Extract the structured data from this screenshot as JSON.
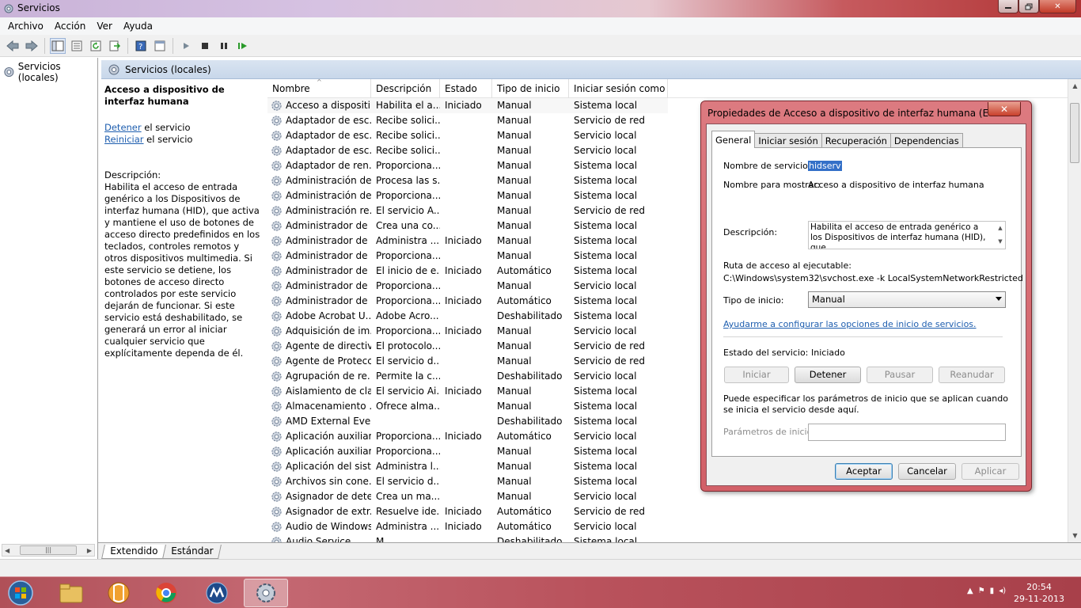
{
  "window": {
    "title": "Servicios"
  },
  "menu": [
    "Archivo",
    "Acción",
    "Ver",
    "Ayuda"
  ],
  "tree": {
    "root_label": "Servicios (locales)"
  },
  "pane": {
    "header": "Servicios (locales)"
  },
  "detail": {
    "title": "Acceso a dispositivo de interfaz humana",
    "stop_link": "Detener",
    "stop_suffix": " el servicio",
    "restart_link": "Reiniciar",
    "restart_suffix": " el servicio",
    "description_label": "Descripción:",
    "description": "Habilita el acceso de entrada genérico a los Dispositivos de interfaz humana (HID), que activa y mantiene el uso de botones de acceso directo predefinidos en los teclados, controles remotos y otros dispositivos multimedia. Si este servicio se detiene, los botones de acceso directo controlados por este servicio dejarán de funcionar. Si este servicio está deshabilitado, se generará un error al iniciar cualquier servicio que explícitamente dependa de él."
  },
  "columns": {
    "name": "Nombre",
    "description": "Descripción",
    "state": "Estado",
    "startup": "Tipo de inicio",
    "logon": "Iniciar sesión como"
  },
  "services": [
    {
      "name": "Acceso a dispositi...",
      "desc": "Habilita el a...",
      "state": "Iniciado",
      "startup": "Manual",
      "logon": "Sistema local"
    },
    {
      "name": "Adaptador de esc...",
      "desc": "Recibe solici...",
      "state": "",
      "startup": "Manual",
      "logon": "Servicio de red"
    },
    {
      "name": "Adaptador de esc...",
      "desc": "Recibe solici...",
      "state": "",
      "startup": "Manual",
      "logon": "Servicio local"
    },
    {
      "name": "Adaptador de esc...",
      "desc": "Recibe solici...",
      "state": "",
      "startup": "Manual",
      "logon": "Servicio local"
    },
    {
      "name": "Adaptador de ren...",
      "desc": "Proporciona...",
      "state": "",
      "startup": "Manual",
      "logon": "Sistema local"
    },
    {
      "name": "Administración de...",
      "desc": "Procesa las s...",
      "state": "",
      "startup": "Manual",
      "logon": "Sistema local"
    },
    {
      "name": "Administración de...",
      "desc": "Proporciona...",
      "state": "",
      "startup": "Manual",
      "logon": "Sistema local"
    },
    {
      "name": "Administración re...",
      "desc": "El servicio A...",
      "state": "",
      "startup": "Manual",
      "logon": "Servicio de red"
    },
    {
      "name": "Administrador de ...",
      "desc": "Crea una co...",
      "state": "",
      "startup": "Manual",
      "logon": "Sistema local"
    },
    {
      "name": "Administrador de ...",
      "desc": "Administra ...",
      "state": "Iniciado",
      "startup": "Manual",
      "logon": "Sistema local"
    },
    {
      "name": "Administrador de ...",
      "desc": "Proporciona...",
      "state": "",
      "startup": "Manual",
      "logon": "Sistema local"
    },
    {
      "name": "Administrador de ...",
      "desc": "El inicio de e...",
      "state": "Iniciado",
      "startup": "Automático",
      "logon": "Sistema local"
    },
    {
      "name": "Administrador de ...",
      "desc": "Proporciona...",
      "state": "",
      "startup": "Manual",
      "logon": "Servicio local"
    },
    {
      "name": "Administrador de ...",
      "desc": "Proporciona...",
      "state": "Iniciado",
      "startup": "Automático",
      "logon": "Sistema local"
    },
    {
      "name": "Adobe Acrobat U...",
      "desc": "Adobe Acro...",
      "state": "",
      "startup": "Deshabilitado",
      "logon": "Sistema local"
    },
    {
      "name": "Adquisición de im...",
      "desc": "Proporciona...",
      "state": "Iniciado",
      "startup": "Manual",
      "logon": "Servicio local"
    },
    {
      "name": "Agente de directiv...",
      "desc": "El protocolo...",
      "state": "",
      "startup": "Manual",
      "logon": "Servicio de red"
    },
    {
      "name": "Agente de Protecc...",
      "desc": "El servicio d...",
      "state": "",
      "startup": "Manual",
      "logon": "Servicio de red"
    },
    {
      "name": "Agrupación de re...",
      "desc": "Permite la c...",
      "state": "",
      "startup": "Deshabilitado",
      "logon": "Servicio local"
    },
    {
      "name": "Aislamiento de cla...",
      "desc": "El servicio Ai...",
      "state": "Iniciado",
      "startup": "Manual",
      "logon": "Sistema local"
    },
    {
      "name": "Almacenamiento ...",
      "desc": "Ofrece alma...",
      "state": "",
      "startup": "Manual",
      "logon": "Sistema local"
    },
    {
      "name": "AMD External Eve...",
      "desc": "",
      "state": "",
      "startup": "Deshabilitado",
      "logon": "Sistema local"
    },
    {
      "name": "Aplicación auxiliar...",
      "desc": "Proporciona...",
      "state": "Iniciado",
      "startup": "Automático",
      "logon": "Servicio local"
    },
    {
      "name": "Aplicación auxiliar...",
      "desc": "Proporciona...",
      "state": "",
      "startup": "Manual",
      "logon": "Sistema local"
    },
    {
      "name": "Aplicación del sist...",
      "desc": "Administra l...",
      "state": "",
      "startup": "Manual",
      "logon": "Sistema local"
    },
    {
      "name": "Archivos sin cone...",
      "desc": "El servicio d...",
      "state": "",
      "startup": "Manual",
      "logon": "Sistema local"
    },
    {
      "name": "Asignador de dete...",
      "desc": "Crea un ma...",
      "state": "",
      "startup": "Manual",
      "logon": "Servicio local"
    },
    {
      "name": "Asignador de extr...",
      "desc": "Resuelve ide...",
      "state": "Iniciado",
      "startup": "Automático",
      "logon": "Servicio de red"
    },
    {
      "name": "Audio de Windows",
      "desc": "Administra ...",
      "state": "Iniciado",
      "startup": "Automático",
      "logon": "Servicio local"
    },
    {
      "name": "Audio Service",
      "desc": "M...",
      "state": "",
      "startup": "Deshabilitado",
      "logon": "Sistema local"
    }
  ],
  "bottom_tabs": [
    "Extendido",
    "Estándar"
  ],
  "dialog": {
    "title": "Propiedades de Acceso a dispositivo de interfaz humana (Equipo ...",
    "tabs": [
      "General",
      "Iniciar sesión",
      "Recuperación",
      "Dependencias"
    ],
    "service_name_label": "Nombre de servicio:",
    "service_name": "hidserv",
    "display_name_label": "Nombre para mostrar:",
    "display_name": "Acceso a dispositivo de interfaz humana",
    "description_label": "Descripción:",
    "description": "Habilita el acceso de entrada genérico a los Dispositivos de interfaz humana (HID), que",
    "path_label": "Ruta de acceso al ejecutable:",
    "path": "C:\\Windows\\system32\\svchost.exe -k LocalSystemNetworkRestricted",
    "startup_label": "Tipo de inicio:",
    "startup_value": "Manual",
    "help_link": "Ayudarme a configurar las opciones de inicio de servicios.",
    "status_label": "Estado del servicio:",
    "status_value": "Iniciado",
    "buttons": {
      "start": "Iniciar",
      "stop": "Detener",
      "pause": "Pausar",
      "resume": "Reanudar"
    },
    "params_hint": "Puede especificar los parámetros de inicio que se aplican cuando se inicia el servicio desde aquí.",
    "params_label": "Parámetros de inicio:",
    "params_value": "",
    "ok": "Aceptar",
    "cancel": "Cancelar",
    "apply": "Aplicar"
  },
  "taskbar": {
    "time": "20:54",
    "date": "29-11-2013"
  },
  "colors": {
    "accent_link": "#1e5eaf",
    "taskbar": "#b9525c",
    "dialog_frame": "#d26068",
    "selection": "#3470c8"
  }
}
